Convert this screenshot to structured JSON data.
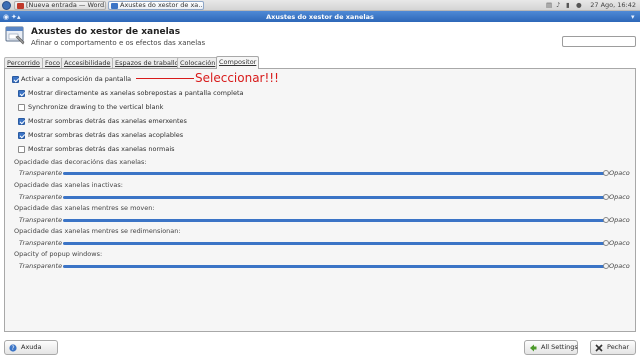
{
  "panel": {
    "tasks": [
      {
        "label": "[Nueva entrada — Word…"
      },
      {
        "label": "Axustes do xestor de xa…"
      }
    ],
    "clock": "27 Ago, 16:42"
  },
  "window": {
    "title": "Axustes do xestor de xanelas"
  },
  "header": {
    "title": "Axustes do xestor de xanelas",
    "subtitle": "Afinar o comportamento e os efectos das xanelas"
  },
  "tabs": [
    "Percorrido",
    "Foco",
    "Accesibilidade",
    "Espazos de traballo",
    "Colocación",
    "Compositor"
  ],
  "compositor": {
    "enable_label": "Activar a composición da pantalla",
    "options": [
      {
        "label": "Mostrar directamente as xanelas sobrepostas a pantalla completa",
        "checked": true
      },
      {
        "label": "Synchronize drawing to the vertical blank",
        "checked": false
      },
      {
        "label": "Mostrar sombras detrás das xanelas emerxentes",
        "checked": true
      },
      {
        "label": "Mostrar sombras detrás das xanelas acoplables",
        "checked": true
      },
      {
        "label": "Mostrar sombras detrás das xanelas normais",
        "checked": false
      }
    ],
    "sliders": [
      {
        "label": "Opacidade das decoracións das xanelas:",
        "min": "Transparente",
        "max": "Opaco",
        "value": 1.0
      },
      {
        "label": "Opacidade das xanelas inactivas:",
        "min": "Transparente",
        "max": "Opaco",
        "value": 1.0
      },
      {
        "label": "Opacidade das xanelas mentres se moven:",
        "min": "Transparente",
        "max": "Opaco",
        "value": 1.0
      },
      {
        "label": "Opacidade das xanelas mentres se redimensionan:",
        "min": "Transparente",
        "max": "Opaco",
        "value": 1.0
      },
      {
        "label": "Opacity of popup windows:",
        "min": "Transparente",
        "max": "Opaco",
        "value": 1.0
      }
    ]
  },
  "annotation": "Seleccionar!!!",
  "footer": {
    "help": "Axuda",
    "all_settings": "All Settings",
    "close": "Pechar"
  },
  "colors": {
    "accent": "#3b74c6",
    "annotation": "#d81b1b",
    "titlebar": "#2d67b8"
  }
}
